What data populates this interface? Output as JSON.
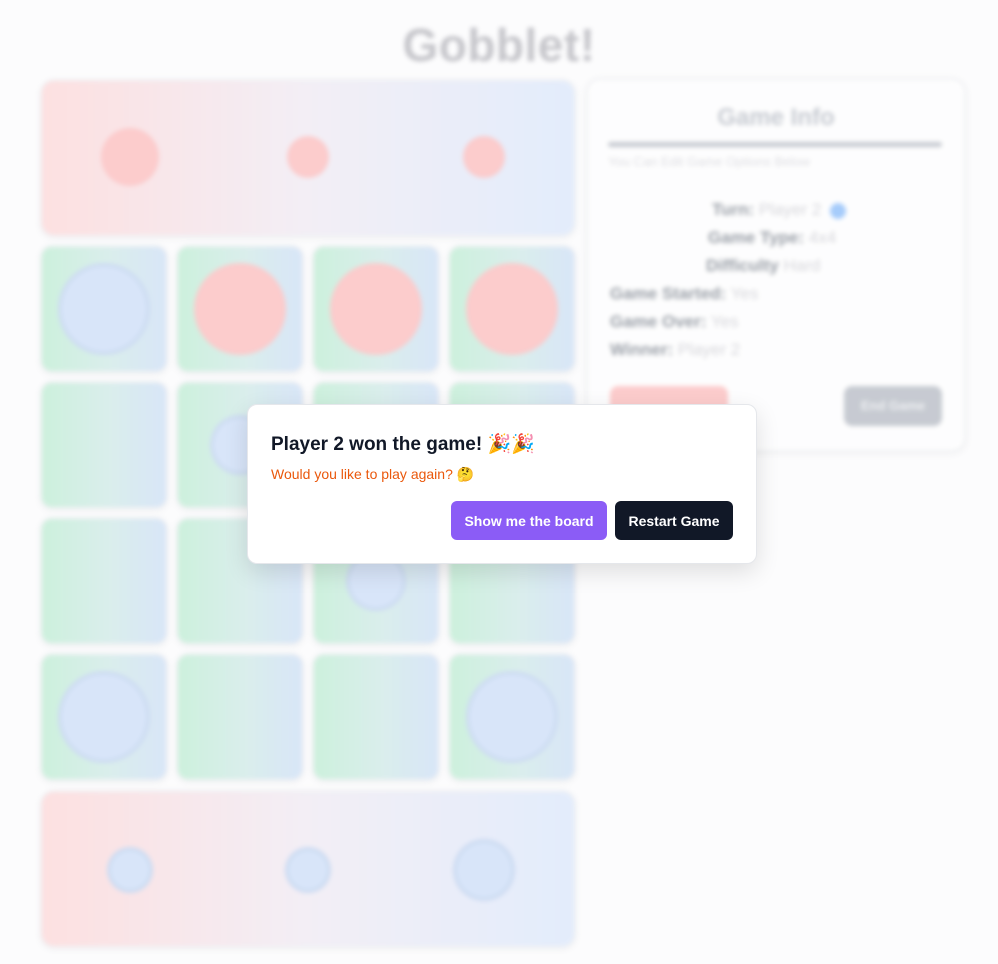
{
  "title": "Gobblet!",
  "dialog": {
    "title": "Player 2 won the game! 🎉🎉",
    "description": "Would you like to play again? 🤔",
    "show_board_label": "Show me the board",
    "restart_label": "Restart Game"
  },
  "game_info": {
    "title": "Game Info",
    "subtitle": "You Can Edit Game Options Below",
    "turn_label": "Turn:",
    "turn_value": "Player 2",
    "game_type_label": "Game Type:",
    "game_type_value": "4x4",
    "difficulty_label": "Difficulty",
    "difficulty_value": "Hard",
    "game_started_label": "Game Started:",
    "game_started_value": "Yes",
    "game_over_label": "Game Over:",
    "game_over_value": "Yes",
    "winner_label": "Winner:",
    "winner_value": "Player 2",
    "end_game_label": "End Game"
  },
  "colors": {
    "player1": "#fca5a5",
    "player2": "#bcd4f7",
    "accent": "#8b5cf6",
    "dark": "#111827",
    "warning": "#ea580c"
  }
}
